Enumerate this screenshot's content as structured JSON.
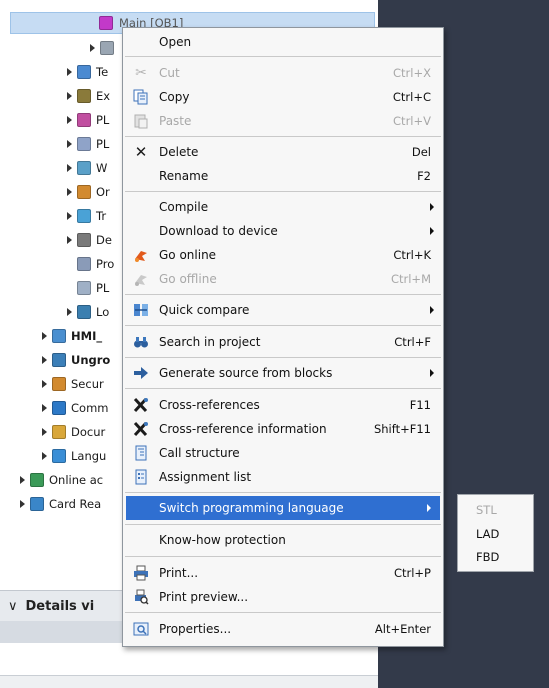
{
  "tree": {
    "selected_item": "Main [OB1]",
    "items": [
      "Te",
      "Ex",
      "PL",
      "PL",
      "W",
      "Or",
      "Tr",
      "De",
      "Pro",
      "PL",
      "Lo",
      "HMI_",
      "Ungro",
      "Secur",
      "Comm",
      "Docur",
      "Langu",
      "Online ac",
      "Card Rea"
    ],
    "details_label": "Details vi",
    "details_chevron": "∨"
  },
  "menu": {
    "open": "Open",
    "cut": "Cut",
    "cut_sc": "Ctrl+X",
    "copy": "Copy",
    "copy_sc": "Ctrl+C",
    "paste": "Paste",
    "paste_sc": "Ctrl+V",
    "delete": "Delete",
    "delete_sc": "Del",
    "rename": "Rename",
    "rename_sc": "F2",
    "compile": "Compile",
    "download": "Download to device",
    "go_online": "Go online",
    "go_online_sc": "Ctrl+K",
    "go_offline": "Go offline",
    "go_offline_sc": "Ctrl+M",
    "quick_compare": "Quick compare",
    "search": "Search in project",
    "search_sc": "Ctrl+F",
    "generate_source": "Generate source from blocks",
    "xref": "Cross-references",
    "xref_sc": "F11",
    "xref_info": "Cross-reference information",
    "xref_info_sc": "Shift+F11",
    "call_structure": "Call structure",
    "assignment_list": "Assignment list",
    "switch_lang": "Switch programming language",
    "knowhow": "Know-how protection",
    "print": "Print...",
    "print_sc": "Ctrl+P",
    "print_preview": "Print preview...",
    "properties": "Properties...",
    "properties_sc": "Alt+Enter"
  },
  "submenu": {
    "stl": "STL",
    "lad": "LAD",
    "fbd": "FBD"
  },
  "colors": {
    "highlight": "#2f6fd1",
    "menu_bg": "#f7f7f7",
    "disabled_text": "#a8a8a8",
    "dark_area": "#333a4a"
  }
}
